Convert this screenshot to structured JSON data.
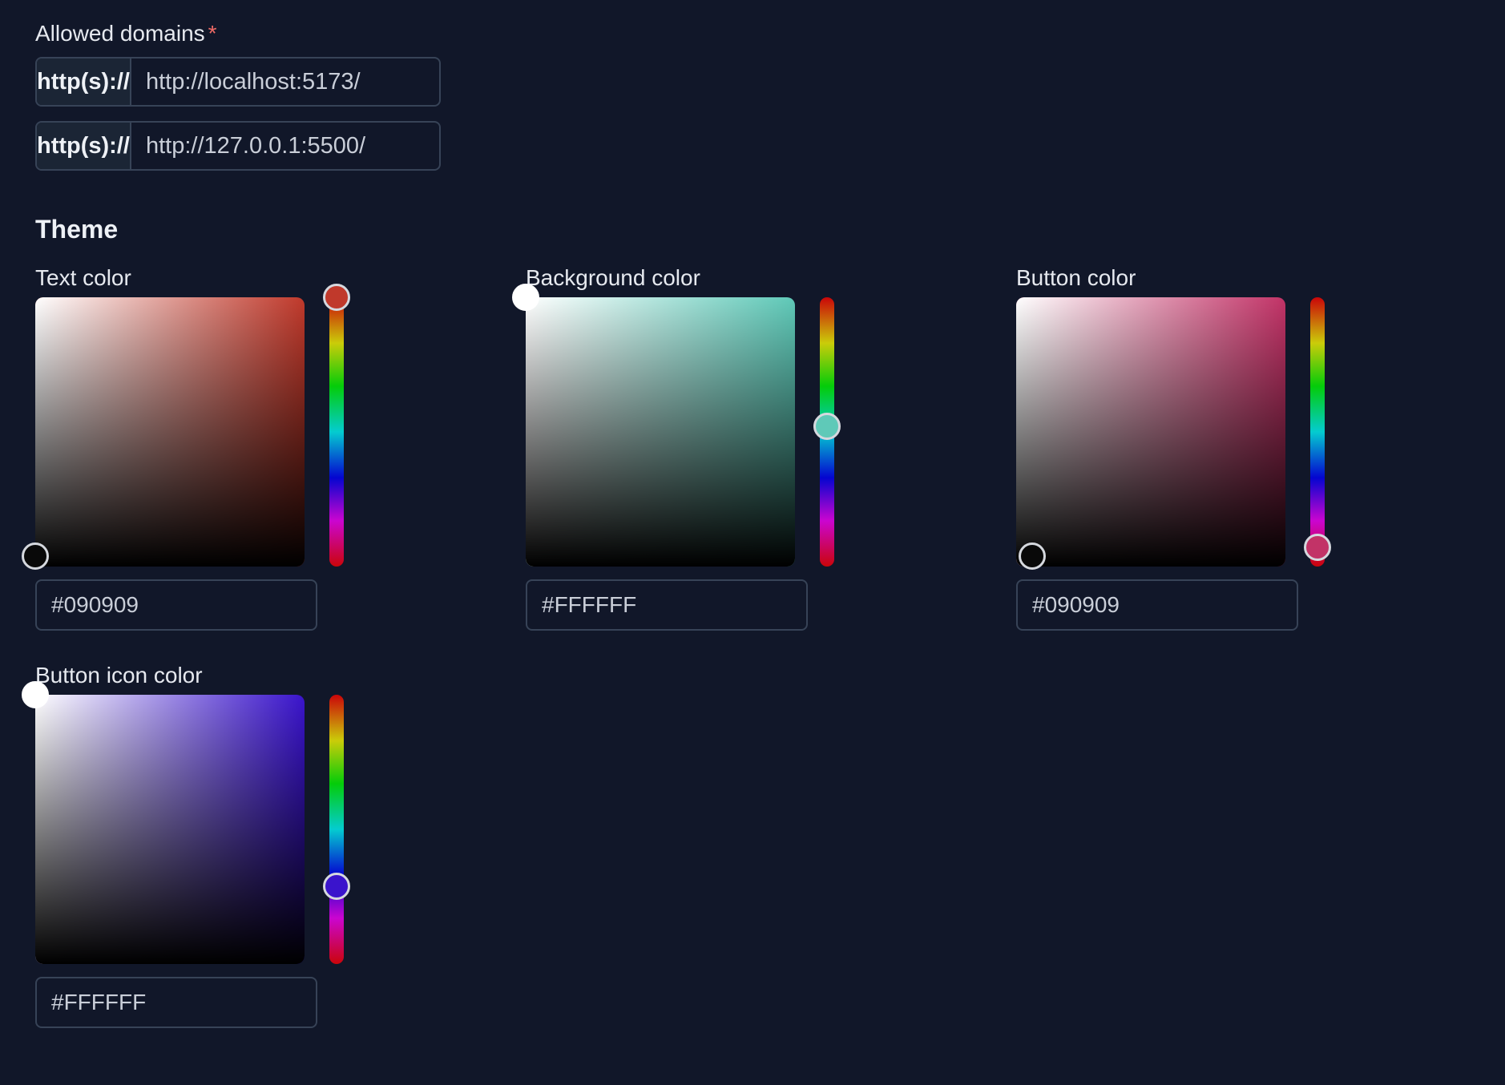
{
  "allowed_domains": {
    "label": "Allowed domains",
    "required_mark": "*",
    "entries": [
      {
        "prefix": "http(s)://",
        "value": "http://localhost:5173/"
      },
      {
        "prefix": "http(s)://",
        "value": "http://127.0.0.1:5500/"
      }
    ]
  },
  "theme": {
    "title": "Theme",
    "pickers": [
      {
        "label": "Text color",
        "hex": "#090909",
        "hue_color": "#c0392b",
        "saturation": 0.0,
        "brightness": 0.04,
        "hue_fraction": 0.0
      },
      {
        "label": "Background color",
        "hex": "#FFFFFF",
        "hue_color": "#5fc9b8",
        "saturation": 0.0,
        "brightness": 1.0,
        "hue_fraction": 0.48
      },
      {
        "label": "Button color",
        "hex": "#090909",
        "hue_color": "#c23367",
        "saturation": 0.06,
        "brightness": 0.04,
        "hue_fraction": 0.93
      },
      {
        "label": "Button icon color",
        "hex": "#FFFFFF",
        "hue_color": "#3a14cc",
        "saturation": 0.0,
        "brightness": 1.0,
        "hue_fraction": 0.71
      }
    ]
  },
  "colors": {
    "page_background": "#111729",
    "border": "#374357",
    "prefix_background": "#1b2535",
    "required": "#f06b66"
  }
}
